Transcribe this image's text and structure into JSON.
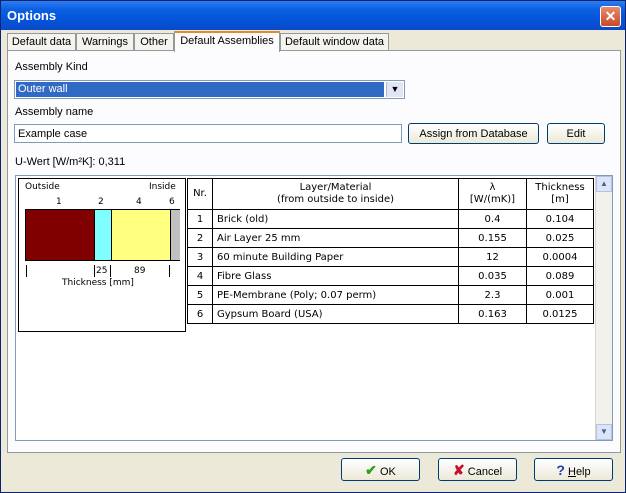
{
  "window": {
    "title": "Options",
    "close_label": "✕"
  },
  "tabs": [
    {
      "label": "Default data",
      "active": false
    },
    {
      "label": "Warnings",
      "active": false
    },
    {
      "label": "Other",
      "active": false
    },
    {
      "label": "Default Assemblies",
      "active": true
    },
    {
      "label": "Default window data",
      "active": false
    }
  ],
  "assembly": {
    "kind_label": "Assembly Kind",
    "kind_value": "Outer wall",
    "name_label": "Assembly name",
    "name_value": "Example case",
    "assign_button": "Assign from Database",
    "edit_button": "Edit",
    "u_value_text": "U-Wert [W/m²K]: 0,311"
  },
  "diagram": {
    "outside_label": "Outside",
    "inside_label": "Inside",
    "layer_numbers": [
      "1",
      "2",
      "4",
      "6"
    ],
    "dimension_values": [
      "25",
      "89"
    ],
    "thickness_label": "Thickness [mm]",
    "colors": {
      "brick": "#800000",
      "air": "#80ffff",
      "fibre": "#ffff80",
      "gypsum": "#c0c0c0"
    }
  },
  "table": {
    "headers": {
      "nr": "Nr.",
      "layer": "Layer/Material",
      "layer_sub": "(from outside to inside)",
      "lambda": "λ",
      "lambda_sub": "[W/(mK)]",
      "thickness": "Thickness",
      "thickness_sub": "[m]"
    },
    "rows": [
      {
        "nr": "1",
        "material": "Brick (old)",
        "lambda": "0.4",
        "thickness": "0.104"
      },
      {
        "nr": "2",
        "material": "Air Layer 25 mm",
        "lambda": "0.155",
        "thickness": "0.025"
      },
      {
        "nr": "3",
        "material": "60 minute Building Paper",
        "lambda": "12",
        "thickness": "0.0004"
      },
      {
        "nr": "4",
        "material": "Fibre Glass",
        "lambda": "0.035",
        "thickness": "0.089"
      },
      {
        "nr": "5",
        "material": "PE-Membrane (Poly; 0.07 perm)",
        "lambda": "2.3",
        "thickness": "0.001"
      },
      {
        "nr": "6",
        "material": "Gypsum Board (USA)",
        "lambda": "0.163",
        "thickness": "0.0125"
      }
    ]
  },
  "footer": {
    "ok": "OK",
    "cancel": "Cancel",
    "help": "Help",
    "help_mnemonic": "H",
    "help_rest": "elp"
  }
}
